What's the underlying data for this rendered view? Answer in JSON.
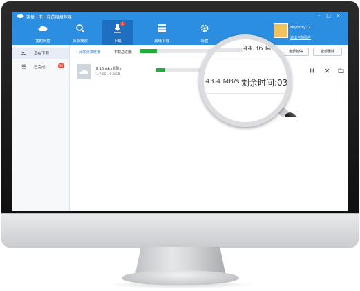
{
  "app": {
    "title": "速盘 · 不一样的度盘神器",
    "window_controls": [
      "-",
      "□",
      "×"
    ]
  },
  "nav": [
    {
      "label": "我的网盘",
      "icon": "cloud-icon"
    },
    {
      "label": "资源搜索",
      "icon": "search-icon"
    },
    {
      "label": "下载",
      "icon": "download-icon",
      "badge": "1",
      "active": true
    },
    {
      "label": "离线下载",
      "icon": "grid-icon"
    },
    {
      "label": "设置",
      "icon": "gear-icon"
    }
  ],
  "user": {
    "name": "skyterry12",
    "logout": "退出当前账户"
  },
  "sidebar": {
    "items": [
      {
        "label": "正在下载",
        "icon": "download-tray-icon",
        "active": true
      },
      {
        "label": "已完成",
        "icon": "list-icon",
        "badge": "99"
      }
    ]
  },
  "toolbar": {
    "add_link": "+ 添加分享链接",
    "overall_label": "下载总进度:",
    "overall_progress": 0.19,
    "pause_all": "全部暂停",
    "delete_all": "全部删除"
  },
  "download": {
    "name": "8.15.mkv删除v",
    "size": "1.7 GB / 9.8 GB",
    "progress": 0.18
  },
  "magnifier": {
    "speed_top": "44.36 MB/s",
    "speed": "43.4 MB/s",
    "eta": "剩余时间:03:"
  },
  "colors": {
    "accent": "#2c8ee0",
    "progress": "#1fae3a",
    "badge": "#e94a3a"
  }
}
